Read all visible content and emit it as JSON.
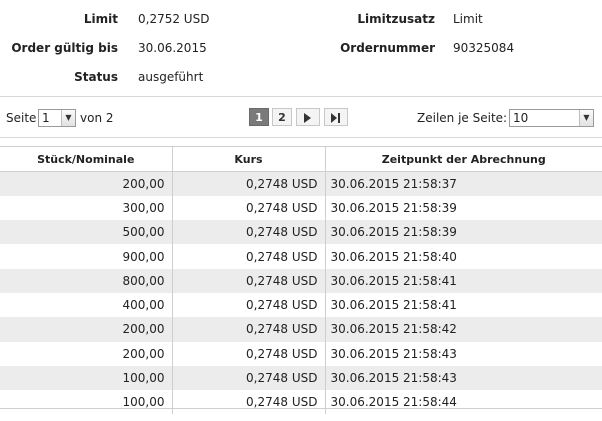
{
  "order": {
    "limit_label": "Limit",
    "limit_value": "0,2752 USD",
    "limitzusatz_label": "Limitzusatz",
    "limitzusatz_value": "Limit",
    "gueltig_label": "Order gültig bis",
    "gueltig_value": "30.06.2015",
    "ordernummer_label": "Ordernummer",
    "ordernummer_value": "90325084",
    "status_label": "Status",
    "status_value": "ausgeführt"
  },
  "pager": {
    "seite_label": "Seite",
    "seite_value": "1",
    "von_label": "von 2",
    "pages": [
      "1",
      "2"
    ],
    "zeilen_label": "Zeilen je Seite:",
    "zeilen_value": "10"
  },
  "table": {
    "headers": [
      "Stück/Nominale",
      "Kurs",
      "Zeitpunkt der Abrechnung"
    ],
    "rows": [
      [
        "200,00",
        "0,2748 USD",
        "30.06.2015 21:58:37"
      ],
      [
        "300,00",
        "0,2748 USD",
        "30.06.2015 21:58:39"
      ],
      [
        "500,00",
        "0,2748 USD",
        "30.06.2015 21:58:39"
      ],
      [
        "900,00",
        "0,2748 USD",
        "30.06.2015 21:58:40"
      ],
      [
        "800,00",
        "0,2748 USD",
        "30.06.2015 21:58:41"
      ],
      [
        "400,00",
        "0,2748 USD",
        "30.06.2015 21:58:41"
      ],
      [
        "200,00",
        "0,2748 USD",
        "30.06.2015 21:58:42"
      ],
      [
        "200,00",
        "0,2748 USD",
        "30.06.2015 21:58:43"
      ],
      [
        "100,00",
        "0,2748 USD",
        "30.06.2015 21:58:43"
      ],
      [
        "100,00",
        "0,2748 USD",
        "30.06.2015 21:58:44"
      ]
    ]
  },
  "icons": {
    "next": "play-next-icon",
    "last": "skip-last-icon",
    "dropdown": "chevron-down-icon"
  }
}
